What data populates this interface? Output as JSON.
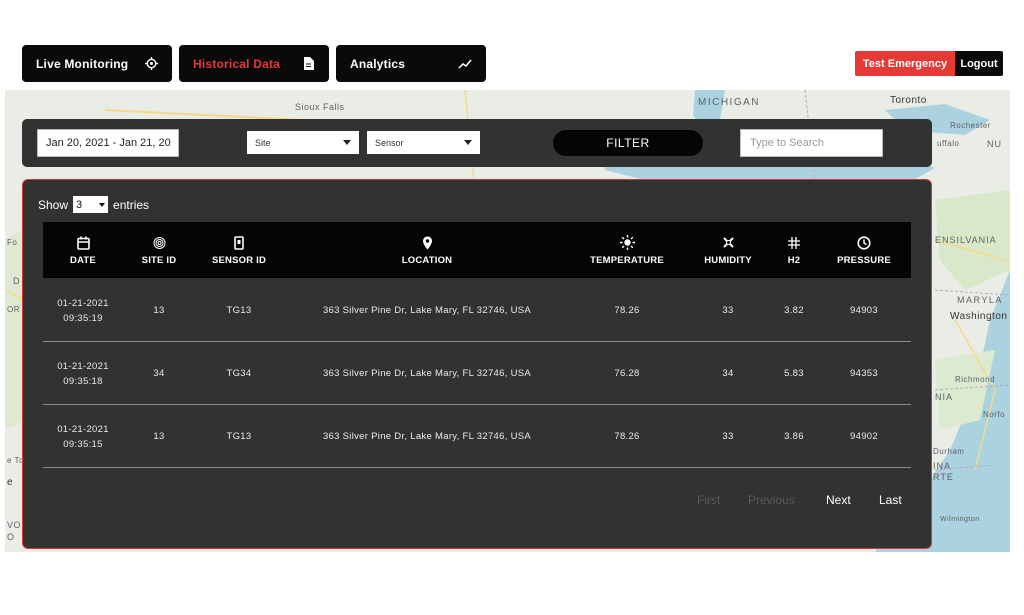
{
  "nav": {
    "live_monitoring": "Live Monitoring",
    "historical_data": "Historical Data",
    "analytics": "Analytics",
    "test_emergency": "Test Emergency",
    "logout": "Logout"
  },
  "map": {
    "labels": [
      "Sioux Falls",
      "MICHIGAN",
      "Toronto",
      "Rochester",
      "uffalo",
      "NU",
      "ENSILVANIA",
      "MARYLA",
      "Washington",
      "Richmond",
      "NIA",
      "Norfo",
      "Durham",
      "INA",
      "RTE",
      "Wilmington",
      "Fo",
      "OR",
      "D",
      "e To",
      "e",
      "VO",
      "O"
    ]
  },
  "filters": {
    "date_range": "Jan 20, 2021 - Jan 21, 20",
    "site": "Site",
    "sensor": "Sensor",
    "filter_button": "FILTER",
    "search_placeholder": "Type to Search"
  },
  "table": {
    "show_label": "Show",
    "entries_value": "3",
    "entries_label": "entries",
    "columns": [
      "DATE",
      "SITE ID",
      "SENSOR ID",
      "LOCATION",
      "TEMPERATURE",
      "HUMIDITY",
      "H2",
      "PRESSURE"
    ],
    "rows": [
      {
        "date": "01-21-2021",
        "time": "09:35:19",
        "site_id": "13",
        "sensor_id": "TG13",
        "location": "363 Silver Pine Dr, Lake Mary, FL 32746, USA",
        "temperature": "78.26",
        "humidity": "33",
        "h2": "3.82",
        "pressure": "94903"
      },
      {
        "date": "01-21-2021",
        "time": "09:35:18",
        "site_id": "34",
        "sensor_id": "TG34",
        "location": "363 Silver Pine Dr, Lake Mary, FL 32746, USA",
        "temperature": "76.28",
        "humidity": "34",
        "h2": "5.83",
        "pressure": "94353"
      },
      {
        "date": "01-21-2021",
        "time": "09:35:15",
        "site_id": "13",
        "sensor_id": "TG13",
        "location": "363 Silver Pine Dr, Lake Mary, FL 32746, USA",
        "temperature": "78.26",
        "humidity": "33",
        "h2": "3.86",
        "pressure": "94902"
      }
    ]
  },
  "pagination": {
    "first": "First",
    "previous": "Previous",
    "next": "Next",
    "last": "Last"
  },
  "colors": {
    "accent_red": "#e53935",
    "panel_dark": "#333232",
    "header_black": "#050505"
  }
}
